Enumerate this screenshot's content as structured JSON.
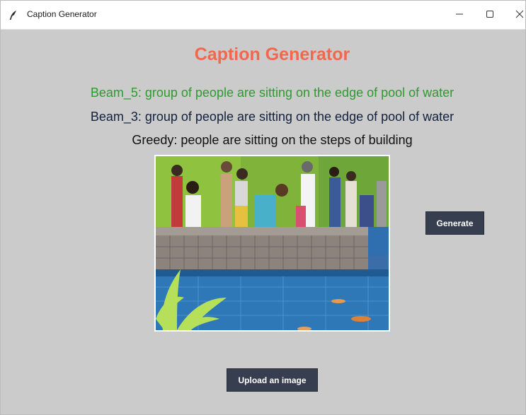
{
  "window": {
    "title": "Caption Generator",
    "minimize_icon": "minimize-icon",
    "maximize_icon": "maximize-icon",
    "close_icon": "close-icon",
    "app_icon": "feather-icon"
  },
  "app": {
    "heading": "Caption Generator",
    "heading_color": "#f0684e"
  },
  "captions": {
    "beam5": "Beam_5: group of people are sitting on the edge of pool of water",
    "beam3": "Beam_3: group of people are sitting on the edge of pool of water",
    "greedy": "Greedy: people are sitting on the steps of building",
    "beam5_color": "#2f9a2f",
    "beam3_color": "#14213d",
    "greedy_color": "#111111"
  },
  "image": {
    "subject": "people-by-koi-pond-photo"
  },
  "buttons": {
    "generate_label": "Generate",
    "upload_label": "Upload an image",
    "color": "#363e4f"
  }
}
